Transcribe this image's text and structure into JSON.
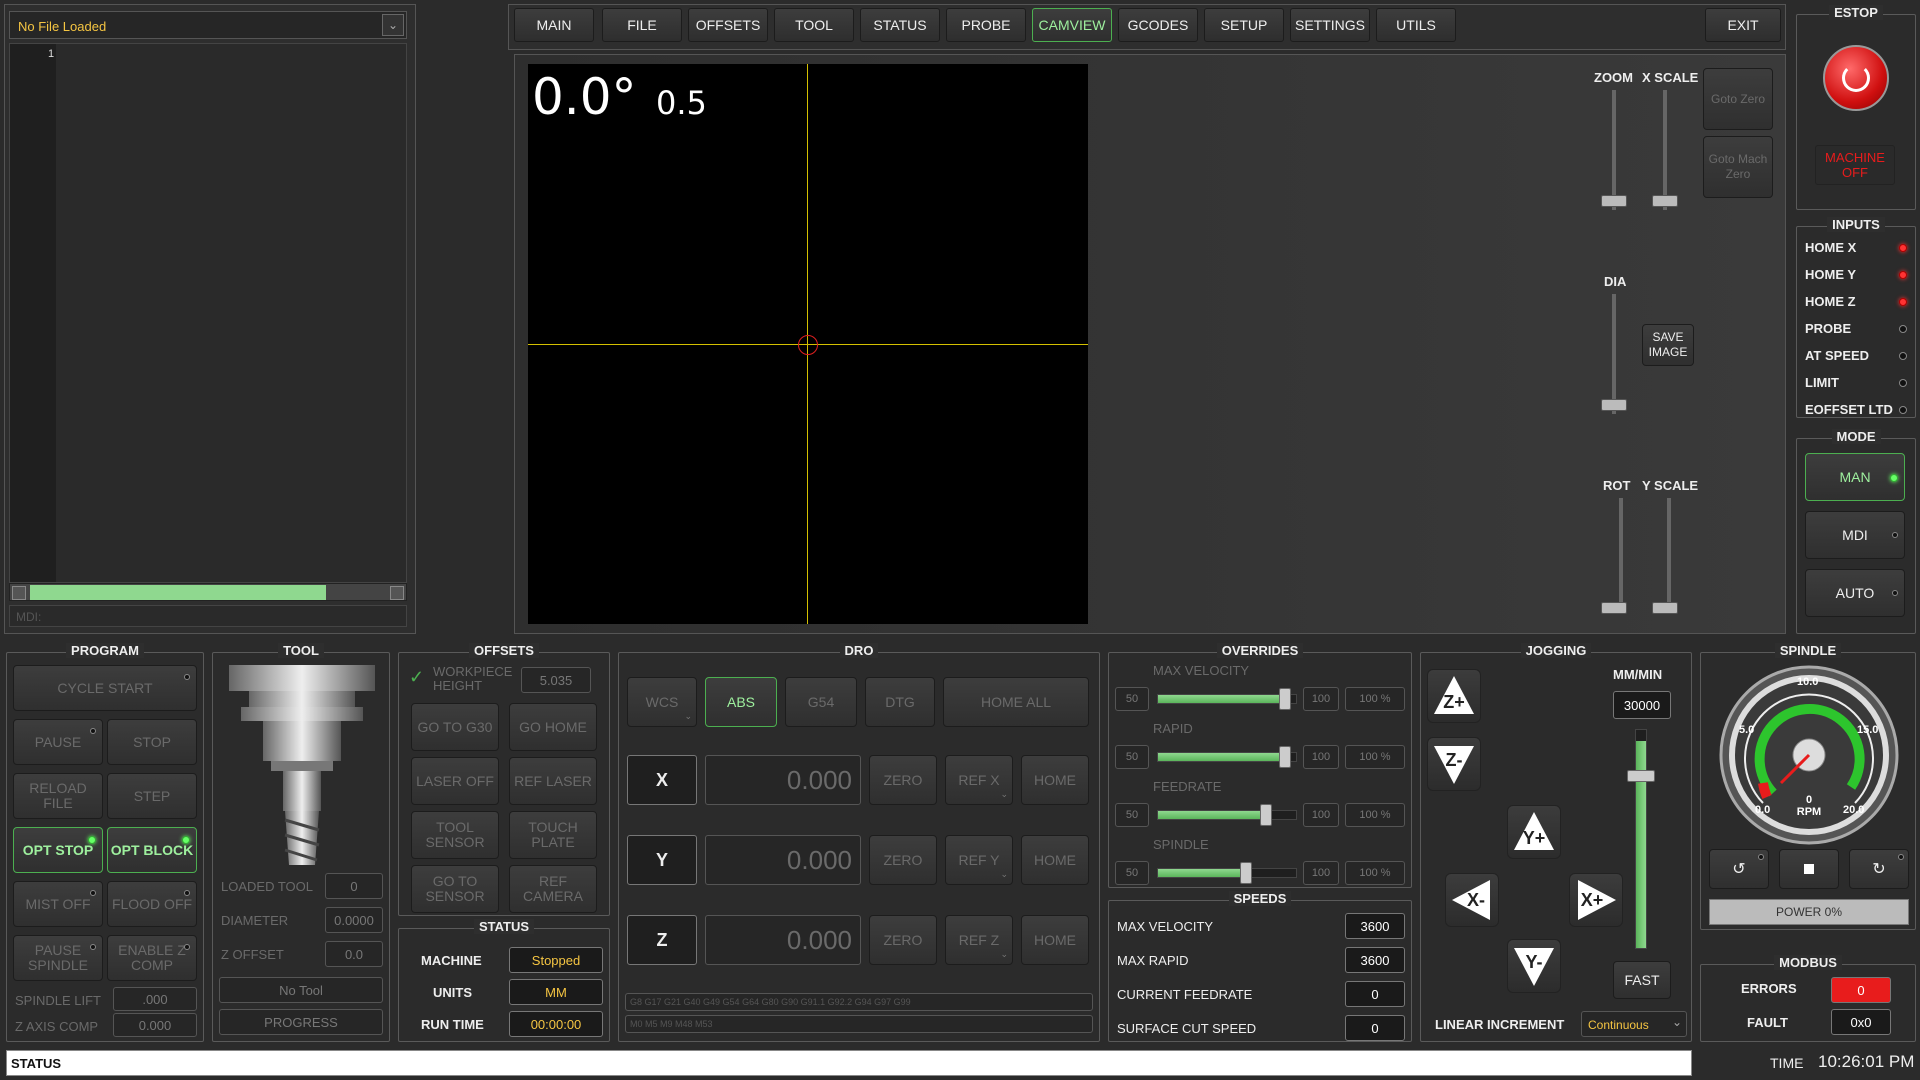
{
  "file": {
    "name": "No File Loaded",
    "line_number": "1",
    "mdi_placeholder": "MDI:"
  },
  "tabs": [
    "MAIN",
    "FILE",
    "OFFSETS",
    "TOOL",
    "STATUS",
    "PROBE",
    "CAMVIEW",
    "GCODES",
    "SETUP",
    "SETTINGS",
    "UTILS"
  ],
  "active_tab": "CAMVIEW",
  "exit_label": "EXIT",
  "camview": {
    "angle_text": "0.0°",
    "scale_text": "0.5",
    "zoom_label": "ZOOM",
    "xscale_label": "X SCALE",
    "dia_label": "DIA",
    "rot_label": "ROT",
    "yscale_label": "Y SCALE",
    "goto_zero": "Goto Zero",
    "goto_mach_zero": "Goto Mach Zero",
    "save_image": "SAVE IMAGE",
    "crosshair_color": "#d4c000",
    "circle_color": "#e02020"
  },
  "estop": {
    "title": "ESTOP",
    "machine_label": "MACHINE OFF"
  },
  "inputs": {
    "title": "INPUTS",
    "items": [
      {
        "label": "HOME X",
        "state": "red"
      },
      {
        "label": "HOME Y",
        "state": "red"
      },
      {
        "label": "HOME Z",
        "state": "red"
      },
      {
        "label": "PROBE",
        "state": "off"
      },
      {
        "label": "AT SPEED",
        "state": "off"
      },
      {
        "label": "LIMIT",
        "state": "off"
      },
      {
        "label": "EOFFSET LTD",
        "state": "off"
      }
    ]
  },
  "mode": {
    "title": "MODE",
    "man": "MAN",
    "mdi": "MDI",
    "auto": "AUTO"
  },
  "program": {
    "title": "PROGRAM",
    "cycle_start": "CYCLE START",
    "pause": "PAUSE",
    "stop": "STOP",
    "reload_file": "RELOAD FILE",
    "step": "STEP",
    "opt_stop": "OPT STOP",
    "opt_block": "OPT BLOCK",
    "mist_off": "MIST OFF",
    "flood_off": "FLOOD OFF",
    "pause_spindle": "PAUSE SPINDLE",
    "enable_zcomp": "ENABLE Z COMP",
    "spindle_lift_label": "SPINDLE LIFT",
    "spindle_lift_value": ".000",
    "z_axis_comp_label": "Z AXIS COMP",
    "z_axis_comp_value": "0.000"
  },
  "tool": {
    "title": "TOOL",
    "loaded_tool_label": "LOADED TOOL",
    "loaded_tool_value": "0",
    "diameter_label": "DIAMETER",
    "diameter_value": "0.0000",
    "z_offset_label": "Z OFFSET",
    "z_offset_value": "0.0",
    "no_tool": "No Tool",
    "progress": "PROGRESS"
  },
  "offsets": {
    "title": "OFFSETS",
    "workpiece_height": "WORKPIECE HEIGHT",
    "workpiece_value": "5.035",
    "go_to_g30": "GO TO G30",
    "go_home": "GO HOME",
    "laser_off": "LASER OFF",
    "ref_laser": "REF LASER",
    "tool_sensor": "TOOL SENSOR",
    "touch_plate": "TOUCH PLATE",
    "go_to_sensor": "GO TO SENSOR",
    "ref_camera": "REF CAMERA"
  },
  "status": {
    "title": "STATUS",
    "machine_label": "MACHINE",
    "machine_value": "Stopped",
    "units_label": "UNITS",
    "units_value": "MM",
    "runtime_label": "RUN TIME",
    "runtime_value": "00:00:00"
  },
  "dro": {
    "title": "DRO",
    "wcs": "WCS",
    "abs": "ABS",
    "g54": "G54",
    "dtg": "DTG",
    "home_all": "HOME ALL",
    "zero": "ZERO",
    "home": "HOME",
    "axes": [
      {
        "name": "X",
        "value": "0.000",
        "ref": "REF X"
      },
      {
        "name": "Y",
        "value": "0.000",
        "ref": "REF Y"
      },
      {
        "name": "Z",
        "value": "0.000",
        "ref": "REF Z"
      }
    ],
    "gcodes": "G8 G17 G21 G40 G49 G54 G64 G80 G90 G91.1 G92.2 G94 G97 G99",
    "mcodes": "M0 M5 M9 M48 M53"
  },
  "overrides": {
    "title": "OVERRIDES",
    "items": [
      {
        "label": "MAX VELOCITY",
        "min": "50",
        "max": "100",
        "pct": "100 %",
        "fraction": 0.92
      },
      {
        "label": "RAPID",
        "min": "50",
        "max": "100",
        "pct": "100 %",
        "fraction": 0.92
      },
      {
        "label": "FEEDRATE",
        "min": "50",
        "max": "100",
        "pct": "100 %",
        "fraction": 0.78
      },
      {
        "label": "SPINDLE",
        "min": "50",
        "max": "100",
        "pct": "100 %",
        "fraction": 0.64
      }
    ]
  },
  "speeds": {
    "title": "SPEEDS",
    "items": [
      {
        "label": "MAX VELOCITY",
        "value": "3600"
      },
      {
        "label": "MAX RAPID",
        "value": "3600"
      },
      {
        "label": "CURRENT FEEDRATE",
        "value": "0"
      },
      {
        "label": "SURFACE CUT SPEED",
        "value": "0"
      }
    ]
  },
  "jogging": {
    "title": "JOGGING",
    "units": "MM/MIN",
    "rate": "30000",
    "fast": "FAST",
    "linear_increment_label": "LINEAR INCREMENT",
    "linear_increment_value": "Continuous",
    "z_plus": "Z+",
    "z_minus": "Z-",
    "y_plus": "Y+",
    "y_minus": "Y-",
    "x_plus": "X+",
    "x_minus": "X-",
    "slider_fraction": 0.95
  },
  "spindle": {
    "title": "SPINDLE",
    "gauge_labels": [
      "0.0",
      "5.0",
      "10.0",
      "15.0",
      "20.0"
    ],
    "rpm_value": "0",
    "rpm_label": "RPM",
    "power": "POWER 0%"
  },
  "modbus": {
    "title": "MODBUS",
    "errors_label": "ERRORS",
    "errors_value": "0",
    "fault_label": "FAULT",
    "fault_value": "0x0"
  },
  "footer": {
    "status": "STATUS",
    "time_label": "TIME",
    "time_value": "10:26:01 PM"
  },
  "colors": {
    "accent": "#4caf50",
    "value_yellow": "#f5c542",
    "error_red": "#e81c1c"
  }
}
